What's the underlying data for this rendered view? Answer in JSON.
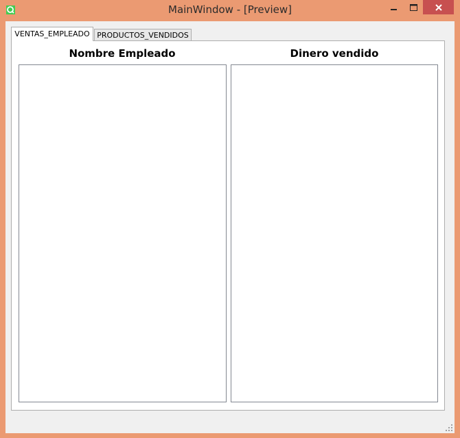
{
  "window": {
    "title": "MainWindow - [Preview]",
    "frame_color": "#eb9a72",
    "close_color": "#c75050"
  },
  "tabs": [
    {
      "label": "VENTAS_EMPLEADO",
      "active": true
    },
    {
      "label": "PRODUCTOS_VENDIDOS",
      "active": false
    }
  ],
  "columns": {
    "left_header": "Nombre Empleado",
    "right_header": "Dinero vendido"
  },
  "icons": {
    "app": "qt-designer-icon",
    "minimize": "minimize-icon",
    "maximize": "maximize-icon",
    "close": "close-icon",
    "grip": "resize-grip-icon"
  }
}
